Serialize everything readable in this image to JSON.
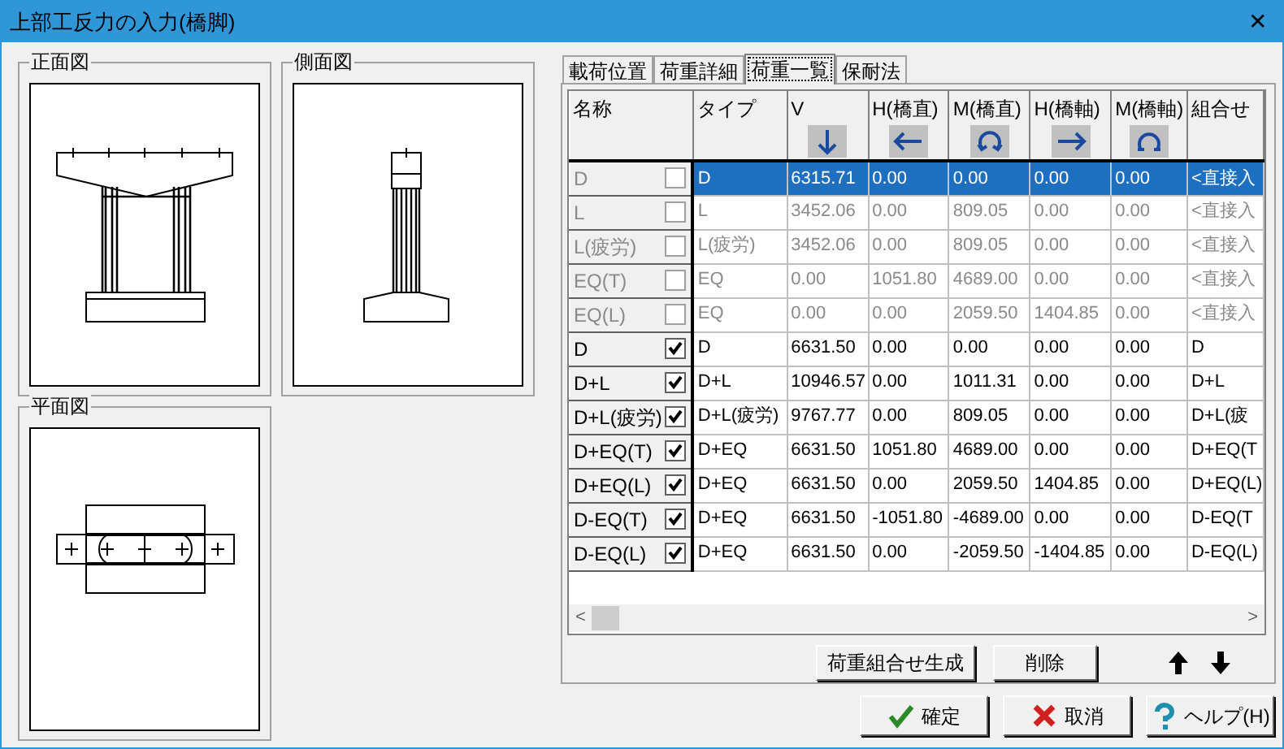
{
  "window": {
    "title": "上部工反力の入力(橋脚)",
    "close": "✕"
  },
  "views": [
    {
      "title": "正面図",
      "kind": "front"
    },
    {
      "title": "側面図",
      "kind": "side"
    },
    {
      "title": "平面図",
      "kind": "plan"
    }
  ],
  "tabs": [
    {
      "label": "載荷位置",
      "selected": false
    },
    {
      "label": "荷重詳細",
      "selected": false
    },
    {
      "label": "荷重一覧",
      "selected": true
    },
    {
      "label": "保耐法",
      "selected": false
    }
  ],
  "table": {
    "columns": [
      "名称",
      "タイプ",
      "V",
      "H(橋直)",
      "M(橋直)",
      "H(橋軸)",
      "M(橋軸)",
      "組合せ"
    ],
    "rows": [
      {
        "checked": false,
        "disabled": true,
        "selected": true,
        "cells": [
          "D",
          "D",
          "6315.71",
          "0.00",
          "0.00",
          "0.00",
          "0.00",
          "<直接入"
        ]
      },
      {
        "checked": false,
        "disabled": true,
        "selected": false,
        "cells": [
          "L",
          "L",
          "3452.06",
          "0.00",
          "809.05",
          "0.00",
          "0.00",
          "<直接入"
        ]
      },
      {
        "checked": false,
        "disabled": true,
        "selected": false,
        "cells": [
          "L(疲労)",
          "L(疲労)",
          "3452.06",
          "0.00",
          "809.05",
          "0.00",
          "0.00",
          "<直接入"
        ]
      },
      {
        "checked": false,
        "disabled": true,
        "selected": false,
        "cells": [
          "EQ(T)",
          "EQ",
          "0.00",
          "1051.80",
          "4689.00",
          "0.00",
          "0.00",
          "<直接入"
        ]
      },
      {
        "checked": false,
        "disabled": true,
        "selected": false,
        "cells": [
          "EQ(L)",
          "EQ",
          "0.00",
          "0.00",
          "2059.50",
          "1404.85",
          "0.00",
          "<直接入"
        ]
      },
      {
        "checked": true,
        "disabled": false,
        "selected": false,
        "cells": [
          "D",
          "D",
          "6631.50",
          "0.00",
          "0.00",
          "0.00",
          "0.00",
          "D"
        ]
      },
      {
        "checked": true,
        "disabled": false,
        "selected": false,
        "cells": [
          "D+L",
          "D+L",
          "10946.57",
          "0.00",
          "1011.31",
          "0.00",
          "0.00",
          "D+L"
        ]
      },
      {
        "checked": true,
        "disabled": false,
        "selected": false,
        "cells": [
          "D+L(疲労)",
          "D+L(疲労)",
          "9767.77",
          "0.00",
          "809.05",
          "0.00",
          "0.00",
          "D+L(疲"
        ]
      },
      {
        "checked": true,
        "disabled": false,
        "selected": false,
        "cells": [
          "D+EQ(T)",
          "D+EQ",
          "6631.50",
          "1051.80",
          "4689.00",
          "0.00",
          "0.00",
          "D+EQ(T"
        ]
      },
      {
        "checked": true,
        "disabled": false,
        "selected": false,
        "cells": [
          "D+EQ(L)",
          "D+EQ",
          "6631.50",
          "0.00",
          "2059.50",
          "1404.85",
          "0.00",
          "D+EQ(L)"
        ]
      },
      {
        "checked": true,
        "disabled": false,
        "selected": false,
        "cells": [
          "D-EQ(T)",
          "D+EQ",
          "6631.50",
          "-1051.80",
          "-4689.00",
          "0.00",
          "0.00",
          "D-EQ(T"
        ]
      },
      {
        "checked": true,
        "disabled": false,
        "selected": false,
        "cells": [
          "D-EQ(L)",
          "D+EQ",
          "6631.50",
          "0.00",
          "-2059.50",
          "-1404.85",
          "0.00",
          "D-EQ(L)"
        ]
      }
    ]
  },
  "scrollbar": {
    "left": "<",
    "right": ">"
  },
  "panel_buttons": [
    "荷重組合せ生成",
    "削除"
  ],
  "footer_buttons": [
    {
      "label": "確定",
      "kind": "ok"
    },
    {
      "label": "取消",
      "kind": "cancel"
    },
    {
      "label": "ヘルプ(H)",
      "kind": "help"
    }
  ]
}
